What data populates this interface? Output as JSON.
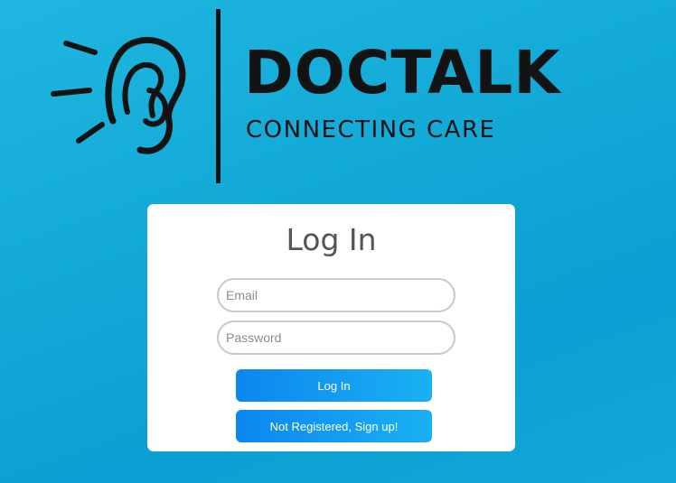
{
  "brand": {
    "name": "DOCTALK",
    "tagline": "CONNECTING CARE",
    "logo_icon": "ear-icon"
  },
  "login": {
    "title": "Log In",
    "email_placeholder": "Email",
    "password_placeholder": "Password",
    "login_button": "Log In",
    "signup_button": "Not Registered, Sign up!"
  },
  "colors": {
    "background": "#11a8d6",
    "card": "#ffffff",
    "button_start": "#0c86f0",
    "button_end": "#1ab1f2",
    "logo_text": "#131313"
  }
}
